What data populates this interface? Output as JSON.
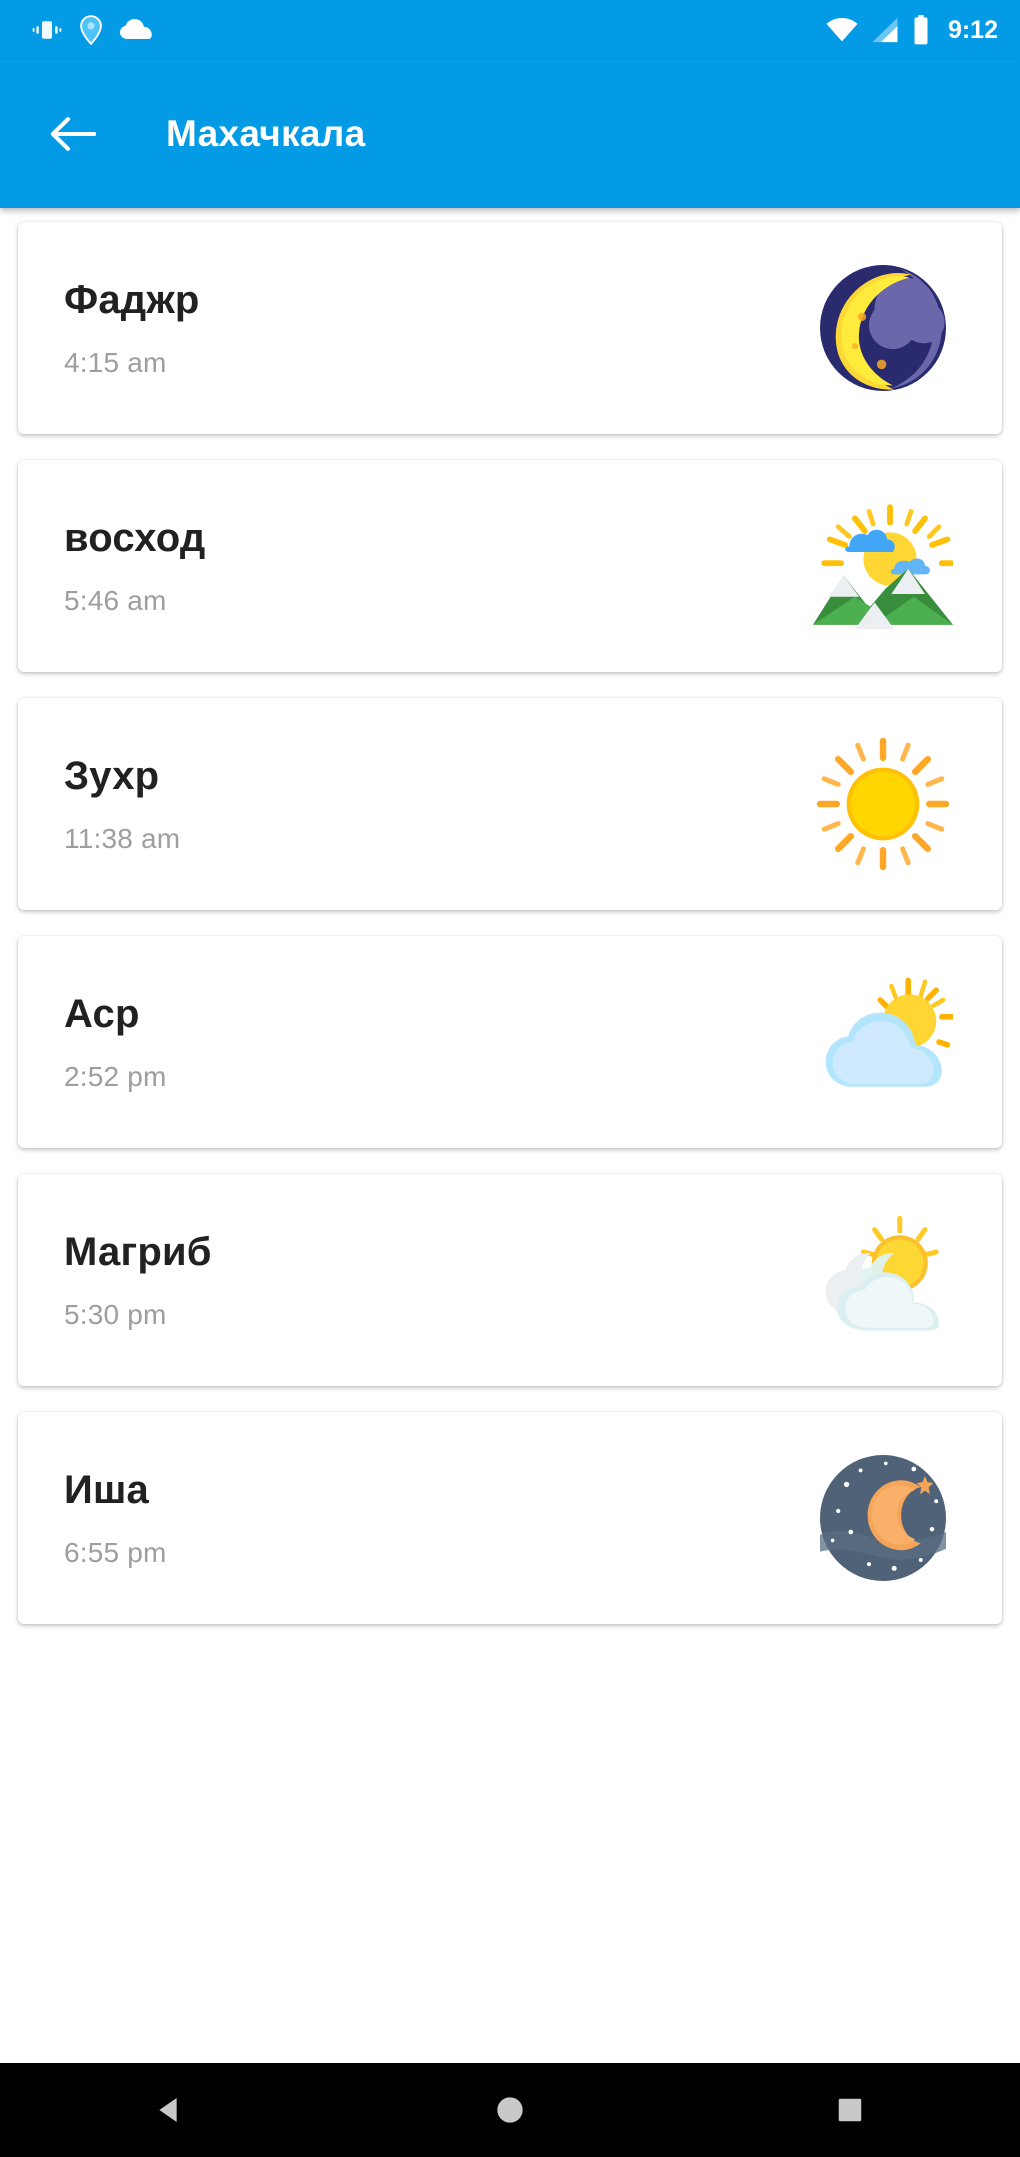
{
  "status_bar": {
    "background_color": "#039be5",
    "time": "9:12",
    "left_icons": [
      {
        "name": "vibrate-icon",
        "glyph": "vibrate"
      },
      {
        "name": "location-icon",
        "glyph": "location"
      },
      {
        "name": "cloud-icon",
        "glyph": "cloud"
      }
    ],
    "right_icons": [
      {
        "name": "wifi-icon",
        "glyph": "wifi"
      },
      {
        "name": "cellular-signal-icon",
        "glyph": "signal"
      },
      {
        "name": "battery-icon",
        "glyph": "battery"
      }
    ]
  },
  "app_bar": {
    "back_label": "back-arrow",
    "title": "Махачкала",
    "background_color": "#039be5",
    "text_color": "#ffffff"
  },
  "prayer_list": [
    {
      "name": "Фаджр",
      "time": "4:15 am",
      "icon": "crescent-moon-icon"
    },
    {
      "name": "восход",
      "time": "5:46 am",
      "icon": "sunrise-over-mountains-icon"
    },
    {
      "name": "Зухр",
      "time": "11:38 am",
      "icon": "sun-icon"
    },
    {
      "name": "Аср",
      "time": "2:52 pm",
      "icon": "sun-behind-cloud-icon"
    },
    {
      "name": "Магриб",
      "time": "5:30 pm",
      "icon": "sun-behind-clouds-sunset-icon"
    },
    {
      "name": "Иша",
      "time": "6:55 pm",
      "icon": "night-with-stars-icon"
    }
  ],
  "nav_bar": {
    "background_color": "#000000",
    "buttons": [
      {
        "name": "back-nav-button",
        "glyph": "triangle-left"
      },
      {
        "name": "home-nav-button",
        "glyph": "circle"
      },
      {
        "name": "recents-nav-button",
        "glyph": "square"
      }
    ]
  },
  "colors": {
    "accent": "#039be5",
    "card_background": "#ffffff",
    "primary_text": "#212121",
    "secondary_text": "#9e9e9e",
    "page_background": "#ffffff"
  }
}
